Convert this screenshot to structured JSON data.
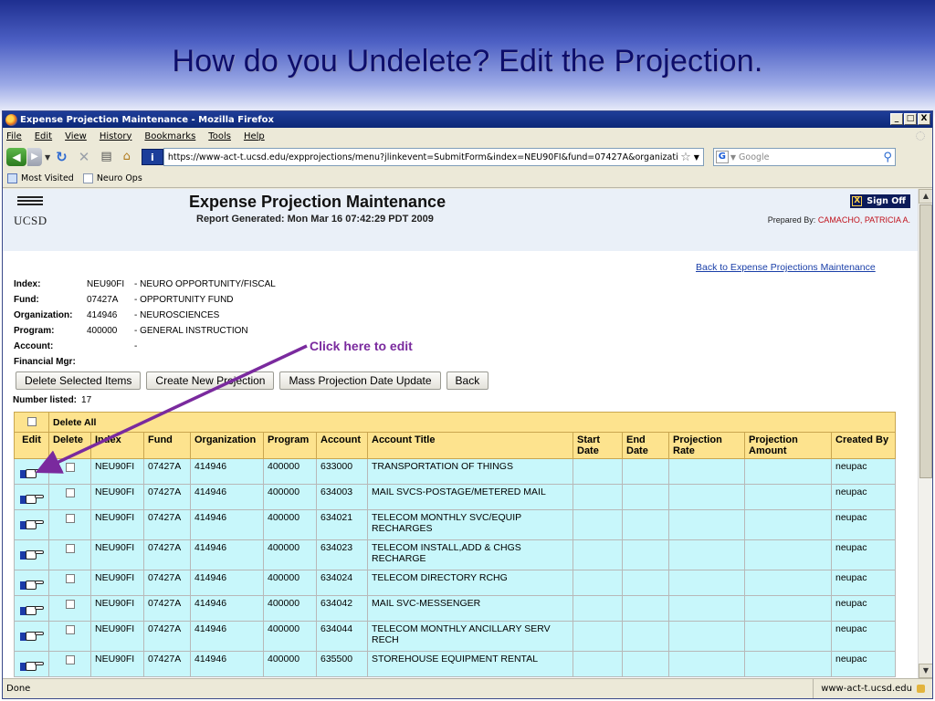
{
  "slide": {
    "title": "How do you Undelete?  Edit the Projection."
  },
  "annotation": {
    "label": "Click here to edit",
    "color": "#7a2a9e"
  },
  "browser": {
    "title": "Expense Projection Maintenance - Mozilla Firefox",
    "window_buttons": [
      "_",
      "□",
      "X"
    ],
    "menu": [
      "File",
      "Edit",
      "View",
      "History",
      "Bookmarks",
      "Tools",
      "Help"
    ],
    "url": "https://www-act-t.ucsd.edu/expprojections/menu?jlinkevent=SubmitForm&index=NEU90FI&fund=07427A&organization=",
    "search_placeholder": "Google",
    "bookmarks": [
      "Most Visited",
      "Neuro Ops"
    ],
    "status_left": "Done",
    "status_right": "www-act-t.ucsd.edu"
  },
  "page": {
    "logo_text": "UCSD",
    "title": "Expense Projection Maintenance",
    "subtitle": "Report Generated: Mon Mar 16 07:42:29 PDT 2009",
    "signoff_label": "Sign Off",
    "prepared_label": "Prepared By:",
    "prepared_name": "CAMACHO, PATRICIA A.",
    "back_link": "Back to Expense Projections Maintenance",
    "info": [
      {
        "label": "Index:",
        "code": "NEU90FI",
        "desc": "- NEURO OPPORTUNITY/FISCAL"
      },
      {
        "label": "Fund:",
        "code": "07427A",
        "desc": "- OPPORTUNITY FUND"
      },
      {
        "label": "Organization:",
        "code": "414946",
        "desc": "- NEUROSCIENCES"
      },
      {
        "label": "Program:",
        "code": "400000",
        "desc": "- GENERAL INSTRUCTION"
      },
      {
        "label": "Account:",
        "code": "",
        "desc": "-"
      },
      {
        "label": "Financial Mgr:",
        "code": "",
        "desc": ""
      }
    ],
    "buttons": [
      "Delete Selected Items",
      "Create New Projection",
      "Mass Projection Date Update",
      "Back"
    ],
    "number_listed_label": "Number listed:",
    "number_listed": "17",
    "delete_all_label": "Delete All",
    "columns": [
      "Edit",
      "Delete",
      "Index",
      "Fund",
      "Organization",
      "Program",
      "Account",
      "Account Title",
      "Start Date",
      "End Date",
      "Projection Rate",
      "Projection Amount",
      "Created By"
    ],
    "rows": [
      {
        "index": "NEU90FI",
        "fund": "07427A",
        "org": "414946",
        "program": "400000",
        "account": "633000",
        "title": "TRANSPORTATION OF THINGS",
        "start": "",
        "end": "",
        "rate": "",
        "amount": "",
        "created_by": "neupac"
      },
      {
        "index": "NEU90FI",
        "fund": "07427A",
        "org": "414946",
        "program": "400000",
        "account": "634003",
        "title": "MAIL SVCS-POSTAGE/METERED MAIL",
        "start": "",
        "end": "",
        "rate": "",
        "amount": "",
        "created_by": "neupac"
      },
      {
        "index": "NEU90FI",
        "fund": "07427A",
        "org": "414946",
        "program": "400000",
        "account": "634021",
        "title": "TELECOM MONTHLY SVC/EQUIP RECHARGES",
        "start": "",
        "end": "",
        "rate": "",
        "amount": "",
        "created_by": "neupac"
      },
      {
        "index": "NEU90FI",
        "fund": "07427A",
        "org": "414946",
        "program": "400000",
        "account": "634023",
        "title": "TELECOM INSTALL,ADD & CHGS RECHARGE",
        "start": "",
        "end": "",
        "rate": "",
        "amount": "",
        "created_by": "neupac"
      },
      {
        "index": "NEU90FI",
        "fund": "07427A",
        "org": "414946",
        "program": "400000",
        "account": "634024",
        "title": "TELECOM DIRECTORY RCHG",
        "start": "",
        "end": "",
        "rate": "",
        "amount": "",
        "created_by": "neupac"
      },
      {
        "index": "NEU90FI",
        "fund": "07427A",
        "org": "414946",
        "program": "400000",
        "account": "634042",
        "title": "MAIL SVC-MESSENGER",
        "start": "",
        "end": "",
        "rate": "",
        "amount": "",
        "created_by": "neupac"
      },
      {
        "index": "NEU90FI",
        "fund": "07427A",
        "org": "414946",
        "program": "400000",
        "account": "634044",
        "title": "TELECOM MONTHLY ANCILLARY SERV RECH",
        "start": "",
        "end": "",
        "rate": "",
        "amount": "",
        "created_by": "neupac"
      },
      {
        "index": "NEU90FI",
        "fund": "07427A",
        "org": "414946",
        "program": "400000",
        "account": "635500",
        "title": "STOREHOUSE EQUIPMENT RENTAL",
        "start": "",
        "end": "",
        "rate": "",
        "amount": "",
        "created_by": "neupac"
      }
    ]
  },
  "colors": {
    "header_yellow": "#fde38e",
    "row_cyan": "#c8f7fb",
    "link_blue": "#1a3fa8",
    "slide_title": "#0d0d6b"
  }
}
